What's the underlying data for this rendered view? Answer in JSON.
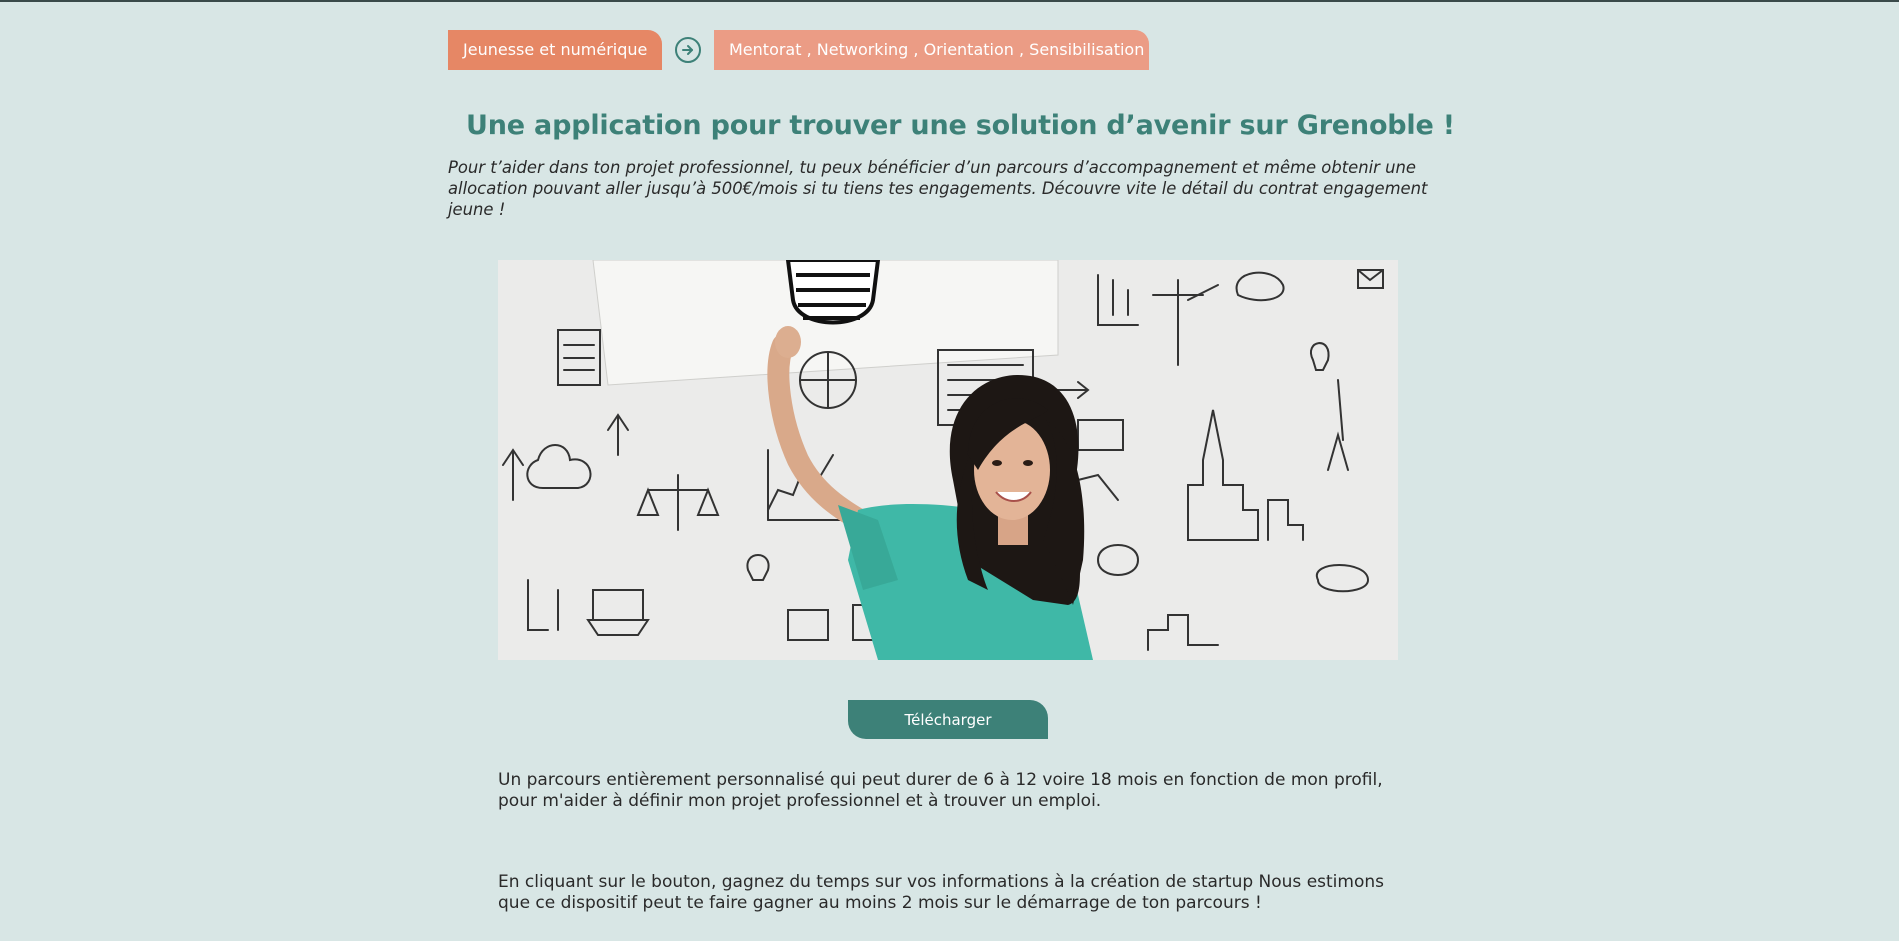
{
  "breadcrumb": {
    "primary_tag": "Jeunesse et numérique",
    "secondary_tag": "Mentorat , Networking , Orientation , Sensibilisation",
    "separator_icon": "arrow-right-circle-icon"
  },
  "page": {
    "title": "Une application pour trouver une solution d’avenir sur Grenoble !",
    "intro": "Pour t’aider dans ton projet professionnel, tu peux bénéficier d’un parcours d’accompagnement et même obtenir une allocation pouvant aller jusqu’à 500€/mois si tu tiens tes engagements. Découvre vite le détail du contrat engagement jeune !",
    "hero_image_alt": "Jeune femme tenant une ampoule dessinée devant un mur de croquis"
  },
  "actions": {
    "download_label": "Télécharger"
  },
  "content": {
    "paragraph_1": "Un parcours entièrement personnalisé qui peut durer de 6 à 12 voire 18 mois en fonction de mon profil, pour m'aider à définir mon projet professionnel et à trouver un emploi.",
    "paragraph_2": "En cliquant sur le bouton, gagnez du temps sur vos informations à la création de startup  Nous estimons que ce dispositif peut te faire gagner au moins 2 mois sur le démarrage de ton parcours !"
  },
  "colors": {
    "background": "#d8e6e5",
    "accent_teal": "#3d8178",
    "tag_primary": "#e68765",
    "tag_secondary": "#eb9c85"
  }
}
